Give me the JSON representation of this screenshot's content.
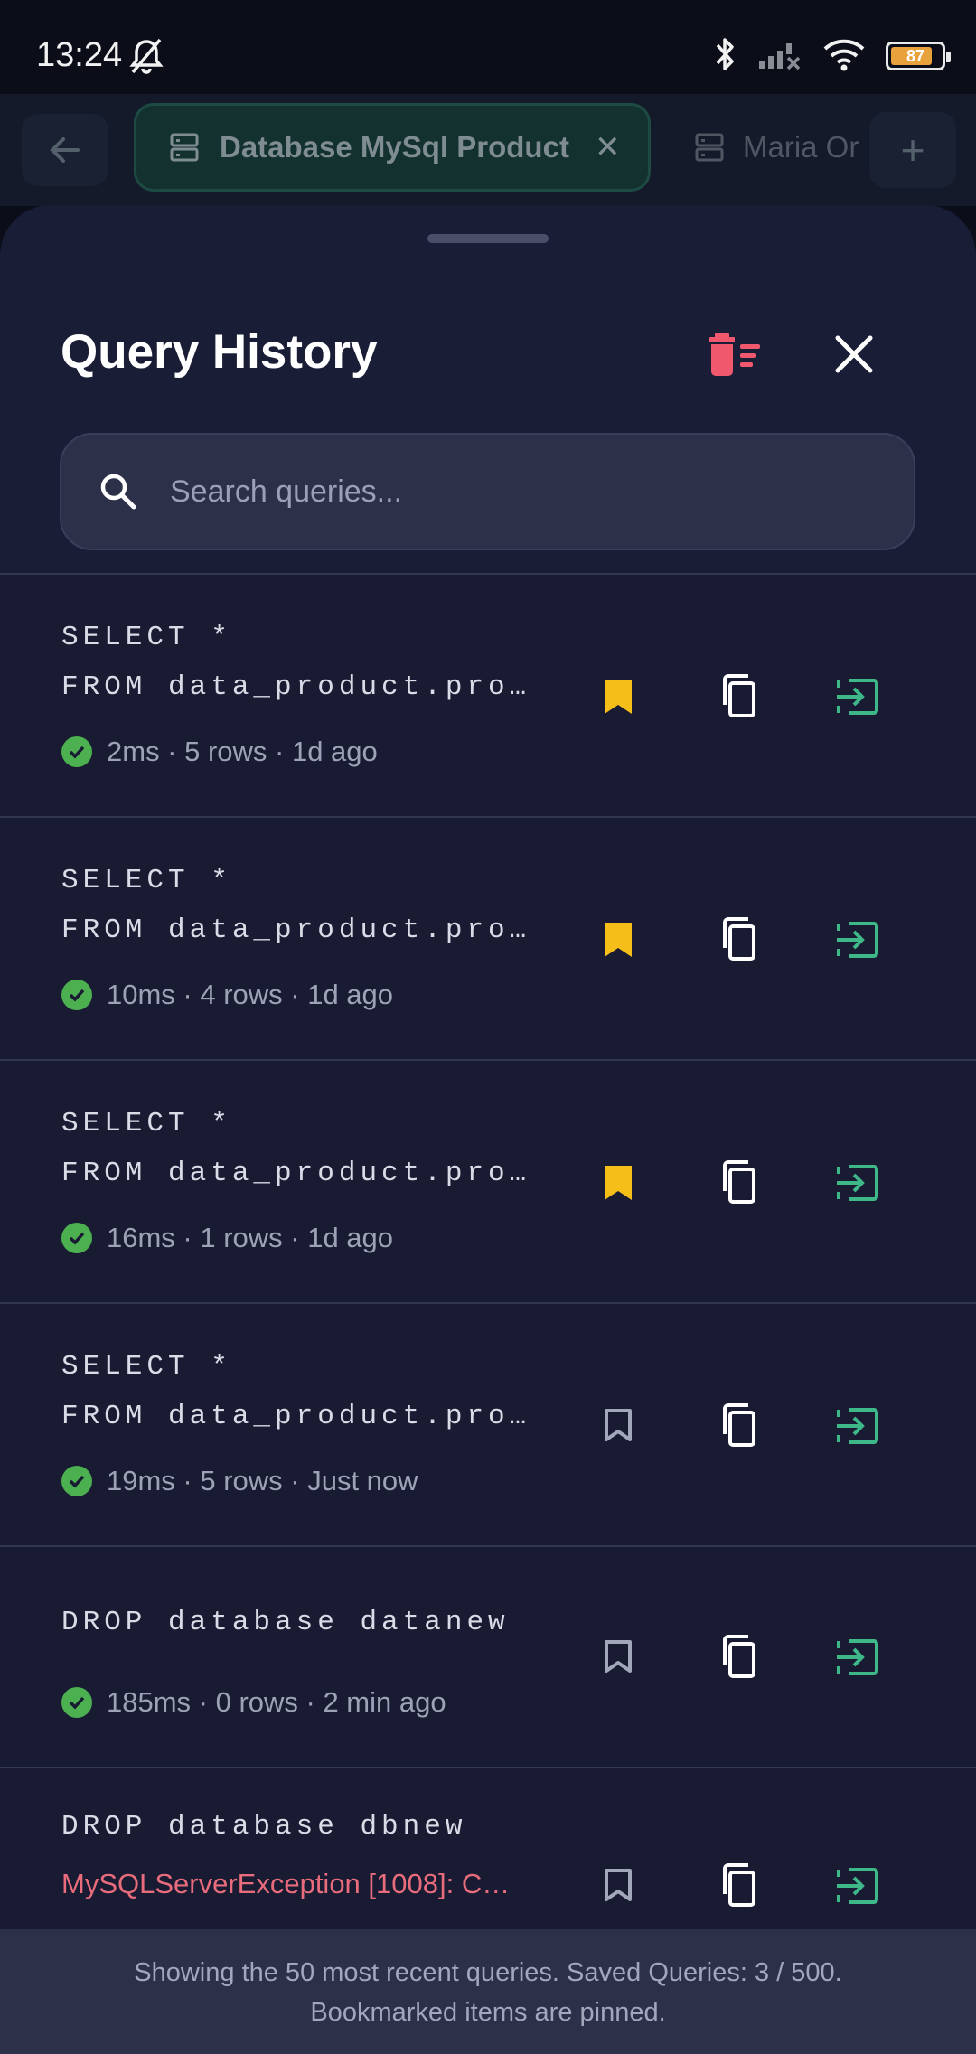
{
  "status_bar": {
    "time": "13:24",
    "battery": "87",
    "icons": [
      "mute-bell-icon",
      "bluetooth-icon",
      "signal-off-icon",
      "wifi-icon",
      "battery-icon"
    ]
  },
  "tabs": {
    "active_label": "Database MySql Product",
    "inactive_label": "Maria Or",
    "add_label": "+"
  },
  "sheet": {
    "title": "Query History",
    "search_placeholder": "Search queries..."
  },
  "colors": {
    "bookmark_active": "#f5be18",
    "run": "#3fb889",
    "clear": "#f0586e",
    "success": "#4caf50",
    "error": "#e86c7c"
  },
  "queries": [
    {
      "line1": "SELECT *",
      "line2": "FROM data_product.pro…",
      "meta": "2ms · 5 rows · 1d ago",
      "bookmarked": true
    },
    {
      "line1": "SELECT *",
      "line2": "FROM data_product.pro…",
      "meta": "10ms · 4 rows · 1d ago",
      "bookmarked": true
    },
    {
      "line1": "SELECT *",
      "line2": "FROM data_product.pro…",
      "meta": "16ms · 1 rows · 1d ago",
      "bookmarked": true
    },
    {
      "line1": "SELECT *",
      "line2": "FROM data_product.pro…",
      "meta": "19ms · 5 rows · Just now",
      "bookmarked": false
    },
    {
      "line1": "DROP database datanew",
      "meta": "185ms · 0 rows · 2 min ago",
      "bookmarked": false
    },
    {
      "line1": "DROP database dbnew",
      "error": "MySQLServerException [1008]: C…",
      "bookmarked": false
    }
  ],
  "footer": {
    "line1": "Showing the 50 most recent queries. Saved Queries: 3 / 500.",
    "line2": "Bookmarked items are pinned."
  }
}
